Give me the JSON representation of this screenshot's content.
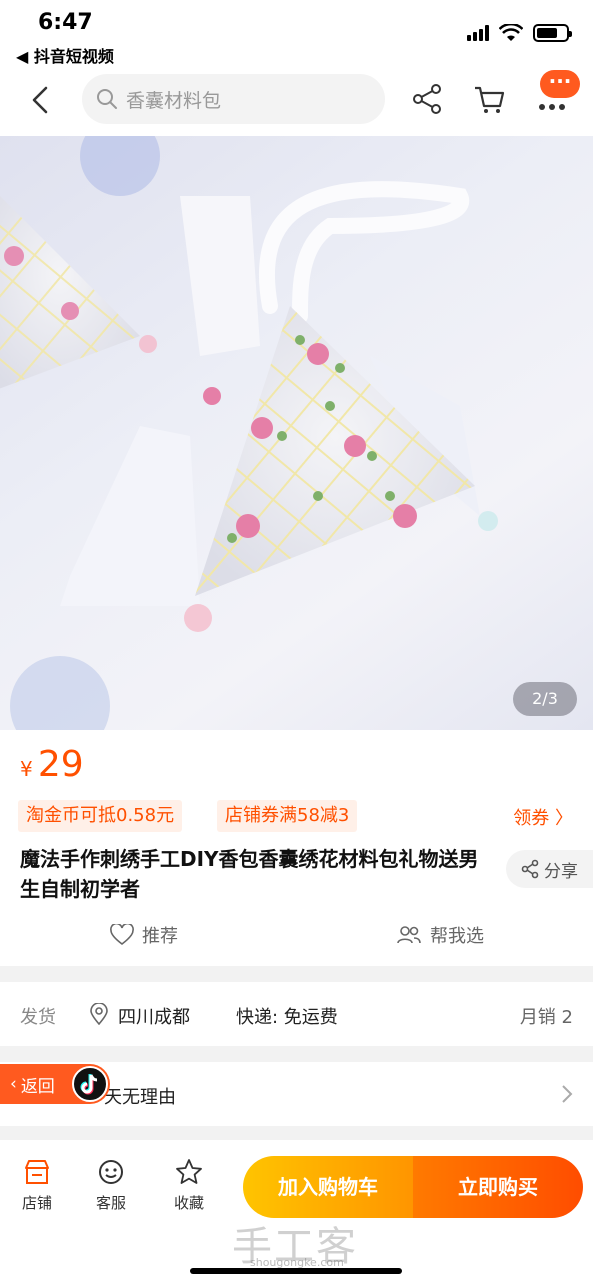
{
  "status_bar": {
    "time": "6:47",
    "back_app": "◀ 抖音短视频"
  },
  "nav": {
    "search_placeholder": "香囊材料包",
    "more_label": "···"
  },
  "gallery": {
    "page_indicator": "2/3"
  },
  "product": {
    "currency": "¥",
    "price": "29",
    "tags": [
      "淘金币可抵0.58元",
      "店铺券满58减3"
    ],
    "coupon_label": "领券 〉",
    "title": "魔法手作刺绣手工DIY香包香囊绣花材料包礼物送男生自制初学者",
    "share_label": "分享",
    "recommend_label": "推荐",
    "help_choose_label": "帮我选"
  },
  "shipping": {
    "label": "发货",
    "location": "四川成都",
    "express": "快递: 免运费",
    "monthly_sales": "月销 2"
  },
  "policy": {
    "text": "天无理由",
    "return_label": "返回"
  },
  "bottom_bar": {
    "shop_label": "店铺",
    "service_label": "客服",
    "favorite_label": "收藏",
    "add_cart_label": "加入购物车",
    "buy_now_label": "立即购买",
    "watermark": "手工客",
    "watermark_sub": "shougongke.com"
  },
  "colors": {
    "accent": "#ff5000",
    "cart_button": "#ffa000",
    "buy_button": "#ff5a00"
  }
}
